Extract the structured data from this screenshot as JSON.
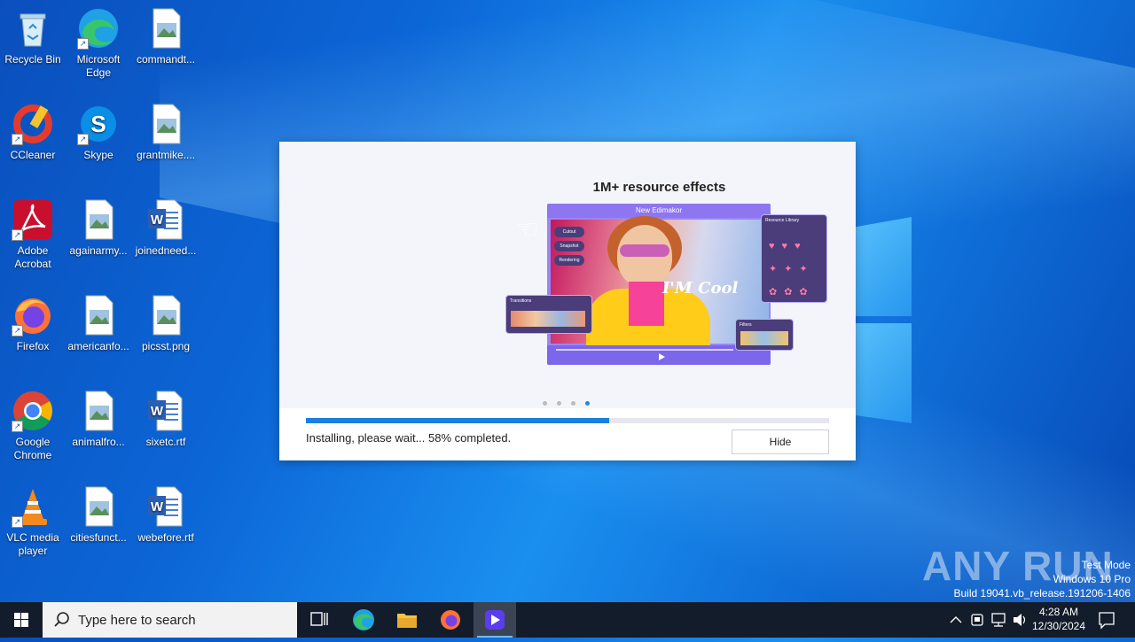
{
  "desktop": {
    "icons": [
      {
        "label": "Recycle Bin"
      },
      {
        "label": "Microsoft Edge"
      },
      {
        "label": "commandt..."
      },
      {
        "label": "CCleaner"
      },
      {
        "label": "Skype"
      },
      {
        "label": "grantmike...."
      },
      {
        "label": "Adobe Acrobat"
      },
      {
        "label": "againarmy..."
      },
      {
        "label": "joinedneed..."
      },
      {
        "label": "Firefox"
      },
      {
        "label": "americanfo..."
      },
      {
        "label": "picsst.png"
      },
      {
        "label": "Google Chrome"
      },
      {
        "label": "animalfro..."
      },
      {
        "label": "sixetc.rtf"
      },
      {
        "label": "VLC media player"
      },
      {
        "label": "citiesfunct..."
      },
      {
        "label": "webefore.rtf"
      }
    ]
  },
  "installer": {
    "title": "1M+ resource effects",
    "illustration": {
      "topbar": "New Edimakor",
      "overlay_text": "I'M Cool",
      "panel_transitions": "Transitions",
      "panel_resource": "Resource Library",
      "panel_filters": "Filters",
      "chips": [
        "Cutout",
        "Snapshot",
        "Rendering"
      ]
    },
    "carousel": {
      "count": 4,
      "active_index": 3
    },
    "progress": {
      "percent": 58
    },
    "status": "Installing, please wait... 58% completed.",
    "hide_label": "Hide"
  },
  "watermark": {
    "text": "ANY RUN",
    "mode": "Test Mode",
    "os": "Windows 10 Pro",
    "build": "Build 19041.vb_release.191206-1406"
  },
  "taskbar": {
    "search_placeholder": "Type here to search",
    "time": "4:28 AM",
    "date": "12/30/2024"
  }
}
